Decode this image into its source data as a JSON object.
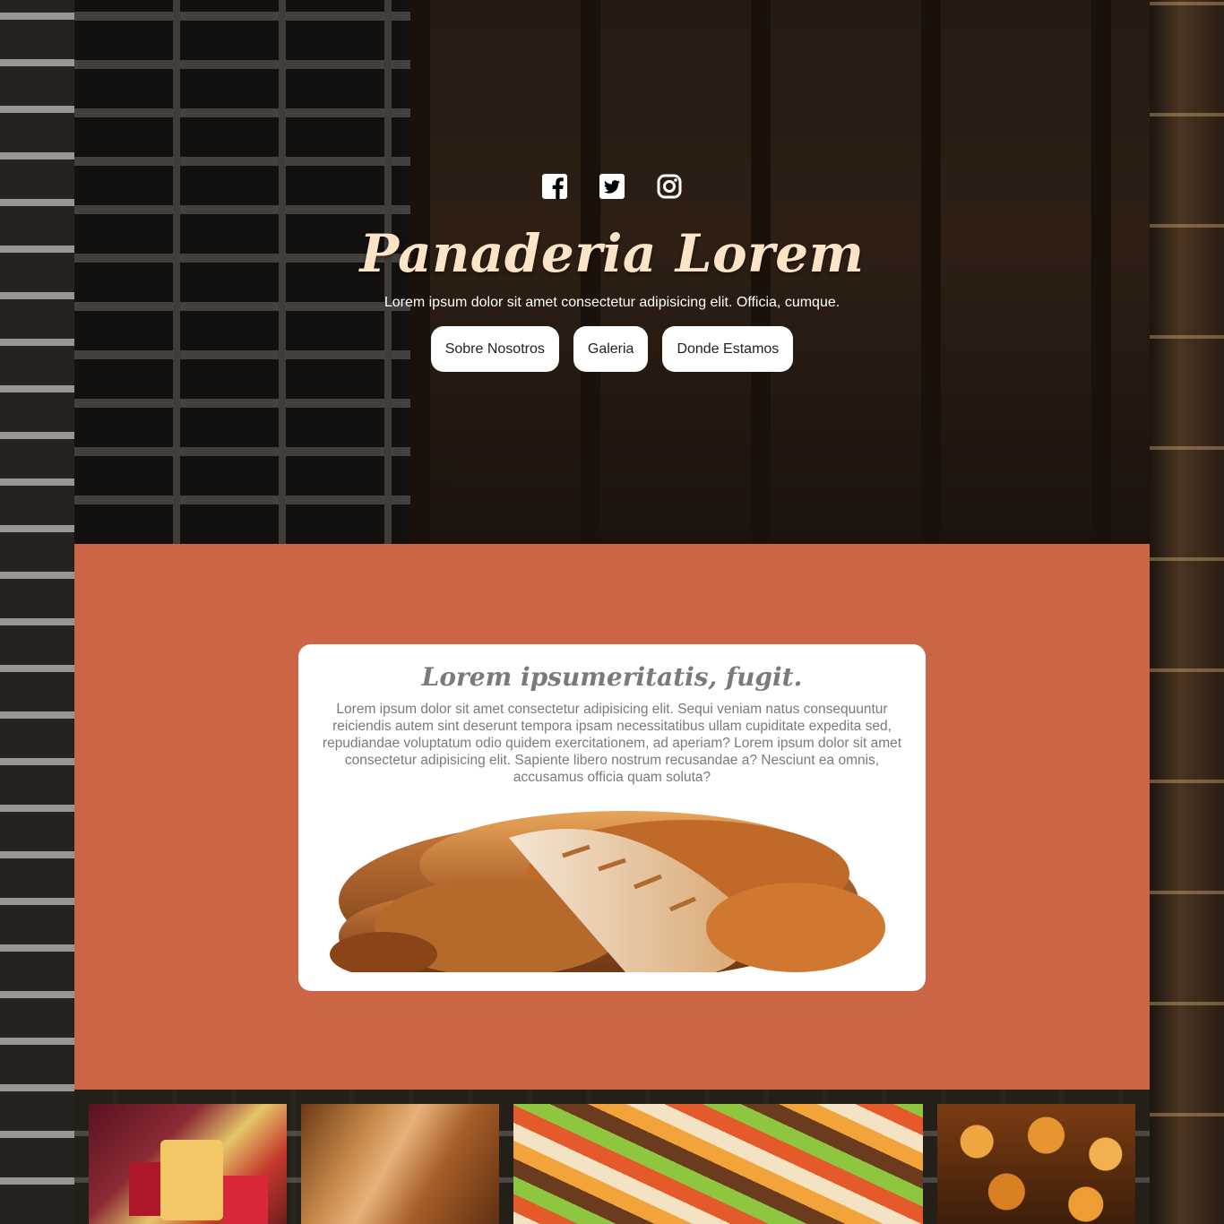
{
  "hero": {
    "socials": [
      {
        "name": "facebook-icon",
        "label": "Facebook"
      },
      {
        "name": "twitter-icon",
        "label": "Twitter"
      },
      {
        "name": "instagram-icon",
        "label": "Instagram"
      }
    ],
    "title": "Panaderia Lorem",
    "tagline": "Lorem ipsum dolor sit amet consectetur adipisicing elit. Officia, cumque.",
    "nav": [
      "Sobre Nosotros",
      "Galeria",
      "Donde Estamos"
    ]
  },
  "about": {
    "heading": "Lorem ipsumeritatis, fugit.",
    "body": "Lorem ipsum dolor sit amet consectetur adipisicing elit. Sequi veniam natus consequuntur reiciendis autem sint deserunt tempora ipsam necessitatibus ullam cupiditate expedita sed, repudiandae voluptatum odio quidem exercitationem, ad aperiam? Lorem ipsum dolor sit amet consectetur adipisicing elit. Sapiente libero nostrum recusandae a? Nesciunt ea omnis, accusamus officia quam soluta?"
  },
  "colors": {
    "brand_title": "#fde4c7",
    "section_bg": "#cb6545",
    "card_text": "#7a7a7a",
    "button_bg": "#ffffff"
  }
}
